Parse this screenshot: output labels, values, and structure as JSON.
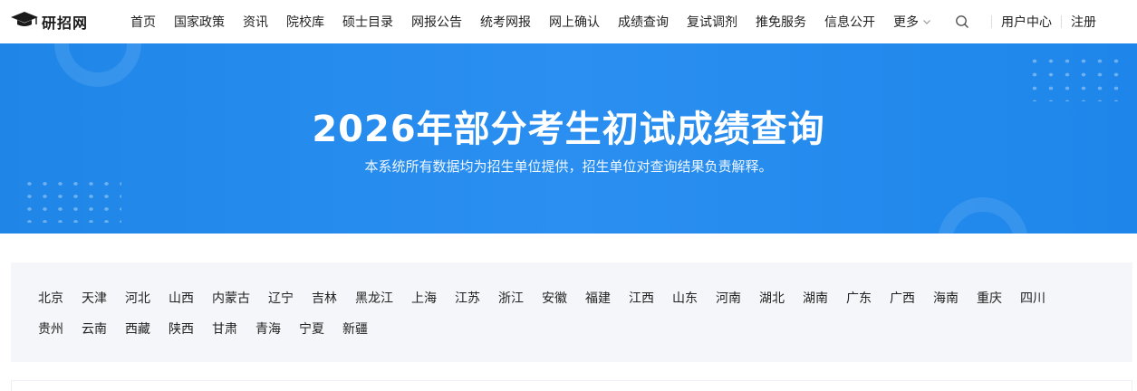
{
  "header": {
    "logo_text": "研招网",
    "nav_items": [
      "首页",
      "国家政策",
      "资讯",
      "院校库",
      "硕士目录",
      "网报公告",
      "统考网报",
      "网上确认",
      "成绩查询",
      "复试调剂",
      "推免服务",
      "信息公开"
    ],
    "more_label": "更多",
    "user_center": "用户中心",
    "register": "注册"
  },
  "banner": {
    "title": "2026年部分考生初试成绩查询",
    "subtitle": "本系统所有数据均为招生单位提供，招生单位对查询结果负责解释。"
  },
  "provinces": {
    "row1": [
      "北京",
      "天津",
      "河北",
      "山西",
      "内蒙古",
      "辽宁",
      "吉林",
      "黑龙江",
      "上海",
      "江苏",
      "浙江",
      "安徽",
      "福建",
      "江西",
      "山东",
      "河南",
      "湖北",
      "湖南",
      "广东",
      "广西",
      "海南",
      "重庆",
      "四川"
    ],
    "row2": [
      "贵州",
      "云南",
      "西藏",
      "陕西",
      "甘肃",
      "青海",
      "宁夏",
      "新疆"
    ]
  },
  "icons": {
    "logo": "graduation-cap-icon",
    "search": "search-icon",
    "more": "chevron-down-icon"
  },
  "colors": {
    "banner": "#2a8ff0",
    "panel": "#f4f6f9"
  }
}
